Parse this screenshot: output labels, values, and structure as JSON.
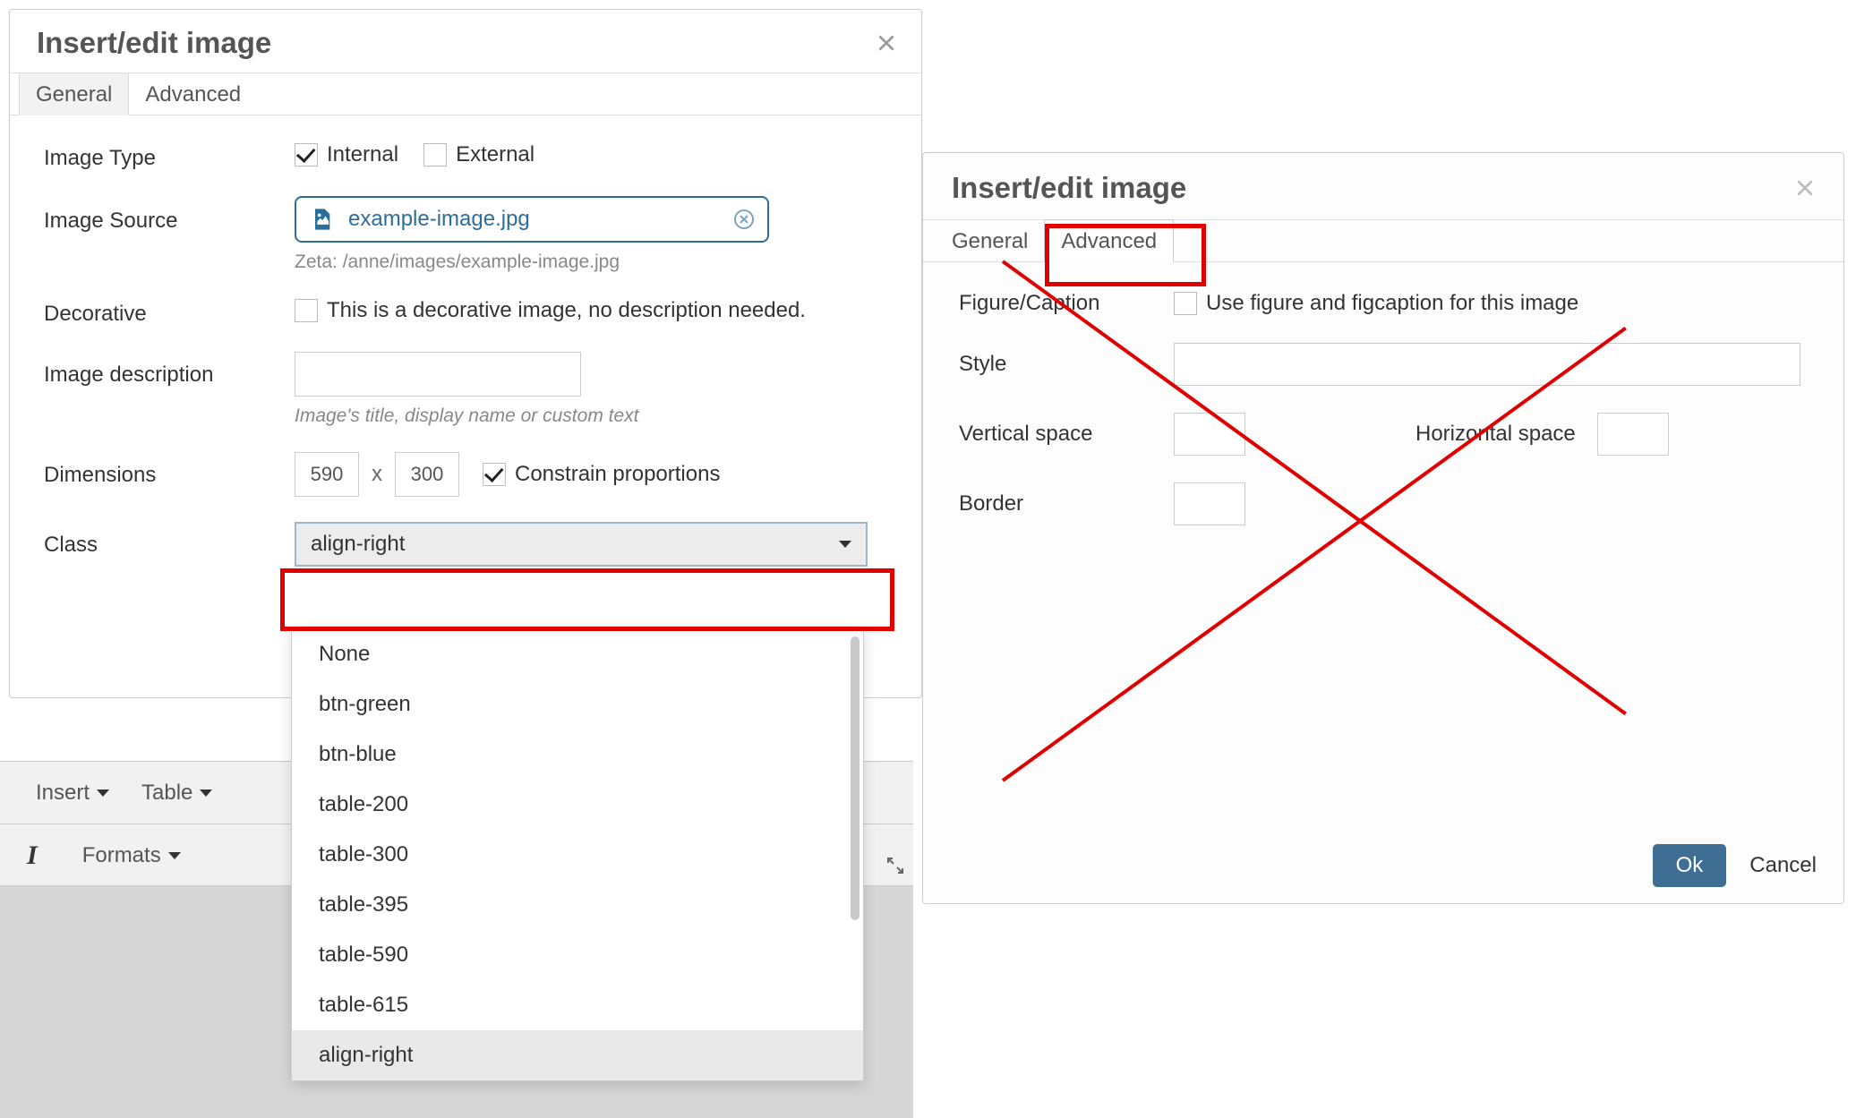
{
  "left": {
    "title": "Insert/edit image",
    "tabs": {
      "general": "General",
      "advanced": "Advanced",
      "active": "General"
    },
    "rows": {
      "image_type": {
        "label": "Image Type",
        "internal_checked": true,
        "internal_label": "Internal",
        "external_checked": false,
        "external_label": "External"
      },
      "image_source": {
        "label": "Image Source",
        "filename": "example-image.jpg",
        "path_hint": "Zeta: /anne/images/example-image.jpg"
      },
      "decorative": {
        "label": "Decorative",
        "checked": false,
        "text": "This is a decorative image, no description needed."
      },
      "image_description": {
        "label": "Image description",
        "value": "",
        "hint": "Image's title, display name or custom text"
      },
      "dimensions": {
        "label": "Dimensions",
        "w": "590",
        "h": "300",
        "sep": "x",
        "constrain_checked": true,
        "constrain_label": "Constrain proportions"
      },
      "class": {
        "label": "Class",
        "selected": "align-right",
        "options": [
          "None",
          "btn-green",
          "btn-blue",
          "table-200",
          "table-300",
          "table-395",
          "table-590",
          "table-615",
          "align-right"
        ]
      }
    },
    "toolbar": {
      "insert": "Insert",
      "table": "Table",
      "formats": "Formats"
    }
  },
  "right": {
    "title": "Insert/edit image",
    "tabs": {
      "general": "General",
      "advanced": "Advanced",
      "active": "Advanced",
      "highlight": "Advanced"
    },
    "rows": {
      "figure": {
        "label": "Figure/Caption",
        "checked": false,
        "text": "Use figure and figcaption for this image"
      },
      "style": {
        "label": "Style",
        "value": ""
      },
      "vspace": {
        "label": "Vertical space",
        "value": ""
      },
      "hspace": {
        "label": "Horizontal space",
        "value": ""
      },
      "border": {
        "label": "Border",
        "value": ""
      }
    },
    "footer": {
      "ok": "Ok",
      "cancel": "Cancel"
    }
  }
}
